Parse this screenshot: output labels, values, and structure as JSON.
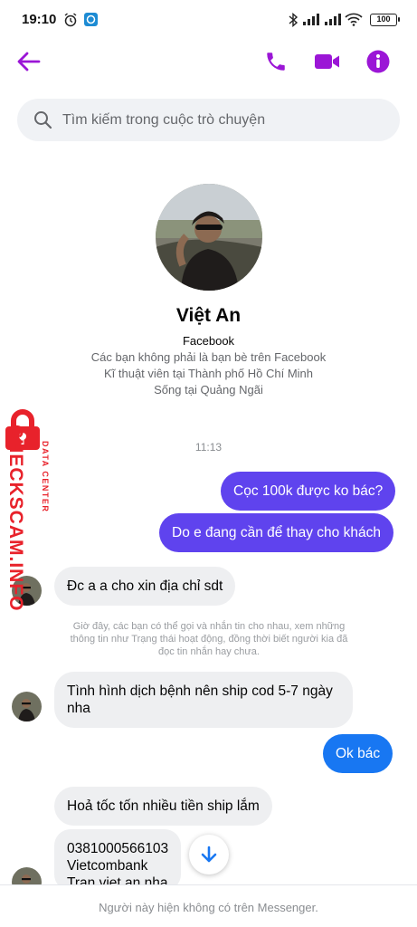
{
  "status_bar": {
    "time": "19:10",
    "battery": "100"
  },
  "header": {
    "back_icon": "arrow-left-icon",
    "call_icon": "phone-icon",
    "video_icon": "video-camera-icon",
    "info_icon": "info-icon",
    "accent": "#9b16d6"
  },
  "search": {
    "placeholder": "Tìm kiếm trong cuộc trò chuyện"
  },
  "profile": {
    "name": "Việt An",
    "source": "Facebook",
    "info": [
      "Các bạn không phải là bạn bè trên Facebook",
      "Kĩ thuật viên tại Thành phố Hồ Chí Minh",
      "Sống tại Quảng Ngãi"
    ]
  },
  "conversation": {
    "timestamp": "11:13",
    "messages": [
      {
        "from": "me",
        "text": "Cọc 100k được ko bác?"
      },
      {
        "from": "me",
        "text": "Do e đang cần để thay cho khách"
      },
      {
        "from": "them",
        "text": "Đc a a cho xin địa chỉ sdt"
      },
      {
        "from": "them",
        "text": "Tình hình dịch bệnh nên ship cod 5-7 ngày nha"
      },
      {
        "from": "me",
        "text": "Ok bác"
      },
      {
        "from": "them",
        "text": "Hoả tốc tốn nhiều tiền ship lắm"
      },
      {
        "from": "them",
        "lines": [
          "0381000566103",
          "Vietcombank",
          "Tran viet an nha"
        ]
      }
    ],
    "notice": "Giờ đây, các bạn có thể gọi và nhắn tin cho nhau, xem những thông tin như Trạng thái hoạt động, đồng thời biết người kia đã đọc tin nhắn hay chưa."
  },
  "footer": {
    "text": "Người này hiện không có trên Messenger."
  },
  "watermark": {
    "main": "CHECKSCAM.INFO",
    "sub": "DATA CENTER"
  },
  "colors": {
    "outgoing": "#5f43ee",
    "outgoing_last": "#1877f2",
    "incoming": "#eeeff1"
  }
}
